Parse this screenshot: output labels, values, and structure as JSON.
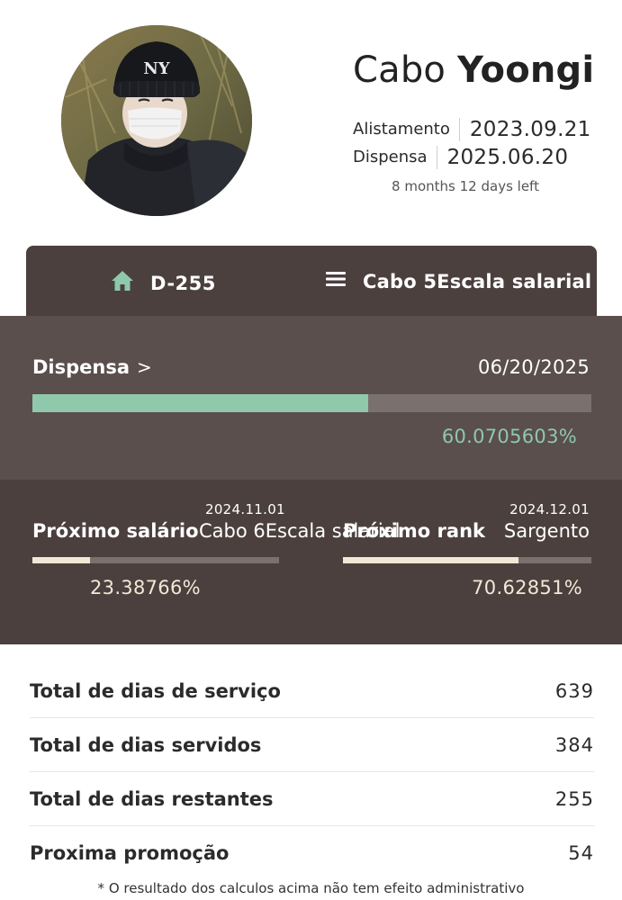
{
  "profile": {
    "rank": "Cabo",
    "name": "Yoongi",
    "enlist_label": "Alistamento",
    "enlist_date": "2023.09.21",
    "discharge_label": "Dispensa",
    "discharge_date": "2025.06.20",
    "remaining": "8 months 12 days left"
  },
  "tabs": {
    "dday": "D-255",
    "rank": "Cabo 5Escala salarial"
  },
  "discharge": {
    "label": "Dispensa",
    "chevron": ">",
    "date": "06/20/2025",
    "progress": 0.600705603,
    "percent_text": "60.0705603%",
    "bar_color": "#8fc8aa"
  },
  "next_salary": {
    "date": "2024.11.01",
    "title": "Próximo salário",
    "value": "Cabo 6Escala salarial",
    "progress": 0.2338766,
    "percent_text": "23.38766%"
  },
  "next_rank": {
    "date": "2024.12.01",
    "title": "Próximo rank",
    "value": "Sargento",
    "progress": 0.7062851,
    "percent_text": "70.62851%"
  },
  "stats": [
    {
      "label": "Total de dias de serviço",
      "value": "639"
    },
    {
      "label": "Total de dias servidos",
      "value": "384"
    },
    {
      "label": "Total de dias restantes",
      "value": "255"
    },
    {
      "label": "Proxima promoção",
      "value": "54"
    }
  ],
  "footnote": "* O resultado dos calculos acima não tem efeito administrativo",
  "icons": {
    "home": "home-icon",
    "menu": "menu-icon"
  },
  "colors": {
    "panel": "#4b403e",
    "accent_green": "#8fc8aa",
    "accent_cream": "#f3e8d6"
  }
}
